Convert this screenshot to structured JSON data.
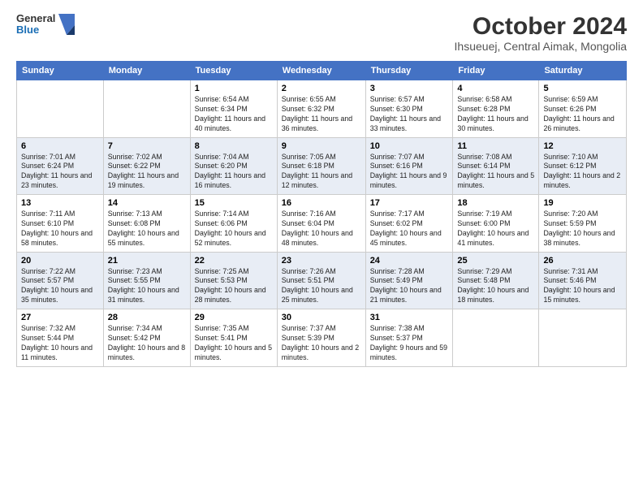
{
  "header": {
    "logo_line1": "General",
    "logo_line2": "Blue",
    "title": "October 2024",
    "subtitle": "Ihsueuej, Central Aimak, Mongolia"
  },
  "weekdays": [
    "Sunday",
    "Monday",
    "Tuesday",
    "Wednesday",
    "Thursday",
    "Friday",
    "Saturday"
  ],
  "weeks": [
    [
      {
        "num": "",
        "info": ""
      },
      {
        "num": "",
        "info": ""
      },
      {
        "num": "1",
        "info": "Sunrise: 6:54 AM\nSunset: 6:34 PM\nDaylight: 11 hours and 40 minutes."
      },
      {
        "num": "2",
        "info": "Sunrise: 6:55 AM\nSunset: 6:32 PM\nDaylight: 11 hours and 36 minutes."
      },
      {
        "num": "3",
        "info": "Sunrise: 6:57 AM\nSunset: 6:30 PM\nDaylight: 11 hours and 33 minutes."
      },
      {
        "num": "4",
        "info": "Sunrise: 6:58 AM\nSunset: 6:28 PM\nDaylight: 11 hours and 30 minutes."
      },
      {
        "num": "5",
        "info": "Sunrise: 6:59 AM\nSunset: 6:26 PM\nDaylight: 11 hours and 26 minutes."
      }
    ],
    [
      {
        "num": "6",
        "info": "Sunrise: 7:01 AM\nSunset: 6:24 PM\nDaylight: 11 hours and 23 minutes."
      },
      {
        "num": "7",
        "info": "Sunrise: 7:02 AM\nSunset: 6:22 PM\nDaylight: 11 hours and 19 minutes."
      },
      {
        "num": "8",
        "info": "Sunrise: 7:04 AM\nSunset: 6:20 PM\nDaylight: 11 hours and 16 minutes."
      },
      {
        "num": "9",
        "info": "Sunrise: 7:05 AM\nSunset: 6:18 PM\nDaylight: 11 hours and 12 minutes."
      },
      {
        "num": "10",
        "info": "Sunrise: 7:07 AM\nSunset: 6:16 PM\nDaylight: 11 hours and 9 minutes."
      },
      {
        "num": "11",
        "info": "Sunrise: 7:08 AM\nSunset: 6:14 PM\nDaylight: 11 hours and 5 minutes."
      },
      {
        "num": "12",
        "info": "Sunrise: 7:10 AM\nSunset: 6:12 PM\nDaylight: 11 hours and 2 minutes."
      }
    ],
    [
      {
        "num": "13",
        "info": "Sunrise: 7:11 AM\nSunset: 6:10 PM\nDaylight: 10 hours and 58 minutes."
      },
      {
        "num": "14",
        "info": "Sunrise: 7:13 AM\nSunset: 6:08 PM\nDaylight: 10 hours and 55 minutes."
      },
      {
        "num": "15",
        "info": "Sunrise: 7:14 AM\nSunset: 6:06 PM\nDaylight: 10 hours and 52 minutes."
      },
      {
        "num": "16",
        "info": "Sunrise: 7:16 AM\nSunset: 6:04 PM\nDaylight: 10 hours and 48 minutes."
      },
      {
        "num": "17",
        "info": "Sunrise: 7:17 AM\nSunset: 6:02 PM\nDaylight: 10 hours and 45 minutes."
      },
      {
        "num": "18",
        "info": "Sunrise: 7:19 AM\nSunset: 6:00 PM\nDaylight: 10 hours and 41 minutes."
      },
      {
        "num": "19",
        "info": "Sunrise: 7:20 AM\nSunset: 5:59 PM\nDaylight: 10 hours and 38 minutes."
      }
    ],
    [
      {
        "num": "20",
        "info": "Sunrise: 7:22 AM\nSunset: 5:57 PM\nDaylight: 10 hours and 35 minutes."
      },
      {
        "num": "21",
        "info": "Sunrise: 7:23 AM\nSunset: 5:55 PM\nDaylight: 10 hours and 31 minutes."
      },
      {
        "num": "22",
        "info": "Sunrise: 7:25 AM\nSunset: 5:53 PM\nDaylight: 10 hours and 28 minutes."
      },
      {
        "num": "23",
        "info": "Sunrise: 7:26 AM\nSunset: 5:51 PM\nDaylight: 10 hours and 25 minutes."
      },
      {
        "num": "24",
        "info": "Sunrise: 7:28 AM\nSunset: 5:49 PM\nDaylight: 10 hours and 21 minutes."
      },
      {
        "num": "25",
        "info": "Sunrise: 7:29 AM\nSunset: 5:48 PM\nDaylight: 10 hours and 18 minutes."
      },
      {
        "num": "26",
        "info": "Sunrise: 7:31 AM\nSunset: 5:46 PM\nDaylight: 10 hours and 15 minutes."
      }
    ],
    [
      {
        "num": "27",
        "info": "Sunrise: 7:32 AM\nSunset: 5:44 PM\nDaylight: 10 hours and 11 minutes."
      },
      {
        "num": "28",
        "info": "Sunrise: 7:34 AM\nSunset: 5:42 PM\nDaylight: 10 hours and 8 minutes."
      },
      {
        "num": "29",
        "info": "Sunrise: 7:35 AM\nSunset: 5:41 PM\nDaylight: 10 hours and 5 minutes."
      },
      {
        "num": "30",
        "info": "Sunrise: 7:37 AM\nSunset: 5:39 PM\nDaylight: 10 hours and 2 minutes."
      },
      {
        "num": "31",
        "info": "Sunrise: 7:38 AM\nSunset: 5:37 PM\nDaylight: 9 hours and 59 minutes."
      },
      {
        "num": "",
        "info": ""
      },
      {
        "num": "",
        "info": ""
      }
    ]
  ]
}
